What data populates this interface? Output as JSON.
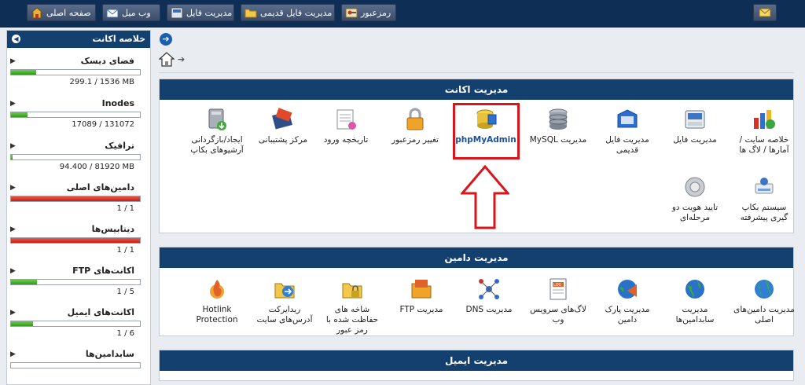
{
  "topbar": {
    "buttons": [
      {
        "label": "صفحه اصلی",
        "icon": "home-icon"
      },
      {
        "label": "وب میل",
        "icon": "webmail-icon"
      },
      {
        "label": "مدیریت فایل",
        "icon": "file-manager-icon"
      },
      {
        "label": "مدیریت فایل قدیمی",
        "icon": "folder-icon"
      },
      {
        "label": "رمزعبور",
        "icon": "password-icon"
      }
    ],
    "mail_icon": "envelope-icon"
  },
  "sidebar": {
    "title": "خلاصه اکانت",
    "stats": [
      {
        "label": "فضای دیسک",
        "value": "299.1 / 1536 MB",
        "fraction": 0.195,
        "color": "green"
      },
      {
        "label": "Inodes",
        "value": "17089 / 131072",
        "fraction": 0.13,
        "color": "green"
      },
      {
        "label": "ترافیک",
        "value": "94.400 / 81920 MB",
        "fraction": 0.01,
        "color": "green"
      },
      {
        "label": "دامین‌های اصلی",
        "value": "1 / 1",
        "fraction": 1.0,
        "color": "red"
      },
      {
        "label": "دیتابیس‌ها",
        "value": "1 / 1",
        "fraction": 1.0,
        "color": "red"
      },
      {
        "label": "اکانت‌های FTP",
        "value": "1 / 5",
        "fraction": 0.2,
        "color": "green"
      },
      {
        "label": "اکانت‌های ایمیل",
        "value": "1 / 6",
        "fraction": 0.17,
        "color": "green"
      },
      {
        "label": "سابدامین‌ها",
        "value": "",
        "fraction": 0.0,
        "color": "green"
      }
    ]
  },
  "account_panel": {
    "title": "مدیریت اکانت",
    "tiles": [
      {
        "label": "خلاصه سایت / آمارها / لاگ ها",
        "icon": "stats-icon"
      },
      {
        "label": "مدیریت فایل",
        "icon": "file-manager-icon"
      },
      {
        "label": "مدیریت فایل قدیمی",
        "icon": "legacy-file-manager-icon"
      },
      {
        "label": "مدیریت MySQL",
        "icon": "database-icon"
      },
      {
        "label": "phpMyAdmin",
        "icon": "phpmyadmin-icon"
      },
      {
        "label": "تغییر رمزعبور",
        "icon": "lock-icon"
      },
      {
        "label": "تاریخچه ورود",
        "icon": "login-history-icon"
      },
      {
        "label": "مرکز پشتیبانی",
        "icon": "support-icon"
      },
      {
        "label": "ایجاد/بازگردانی آرشیوهای بکاپ",
        "icon": "backup-archive-icon"
      },
      {
        "label": "سیستم بکاپ گیری پیشرفته",
        "icon": "backup-system-icon"
      },
      {
        "label": "تایید هویت دو مرحله‌ای",
        "icon": "two-factor-icon"
      }
    ]
  },
  "domain_panel": {
    "title": "مدیریت دامین",
    "tiles": [
      {
        "label": "مدیریت دامین‌های اصلی",
        "icon": "globe-icon"
      },
      {
        "label": "مدیریت سابدامین‌ها",
        "icon": "subdomain-globe-icon"
      },
      {
        "label": "مدیریت پارک دامین",
        "icon": "parked-domain-icon"
      },
      {
        "label": "لاگ‌های سرویس وب",
        "icon": "log-file-icon"
      },
      {
        "label": "مدیریت DNS",
        "icon": "dns-icon"
      },
      {
        "label": "مدیریت FTP",
        "icon": "ftp-icon"
      },
      {
        "label": "شاخه های حفاظت شده با رمز عبور",
        "icon": "protected-folder-icon"
      },
      {
        "label": "ریدایرکت آدرس‌های سایت",
        "icon": "redirect-icon"
      },
      {
        "label": "Hotlink Protection",
        "icon": "hotlink-icon"
      }
    ]
  },
  "email_panel": {
    "title": "مدیریت ایمیل"
  }
}
